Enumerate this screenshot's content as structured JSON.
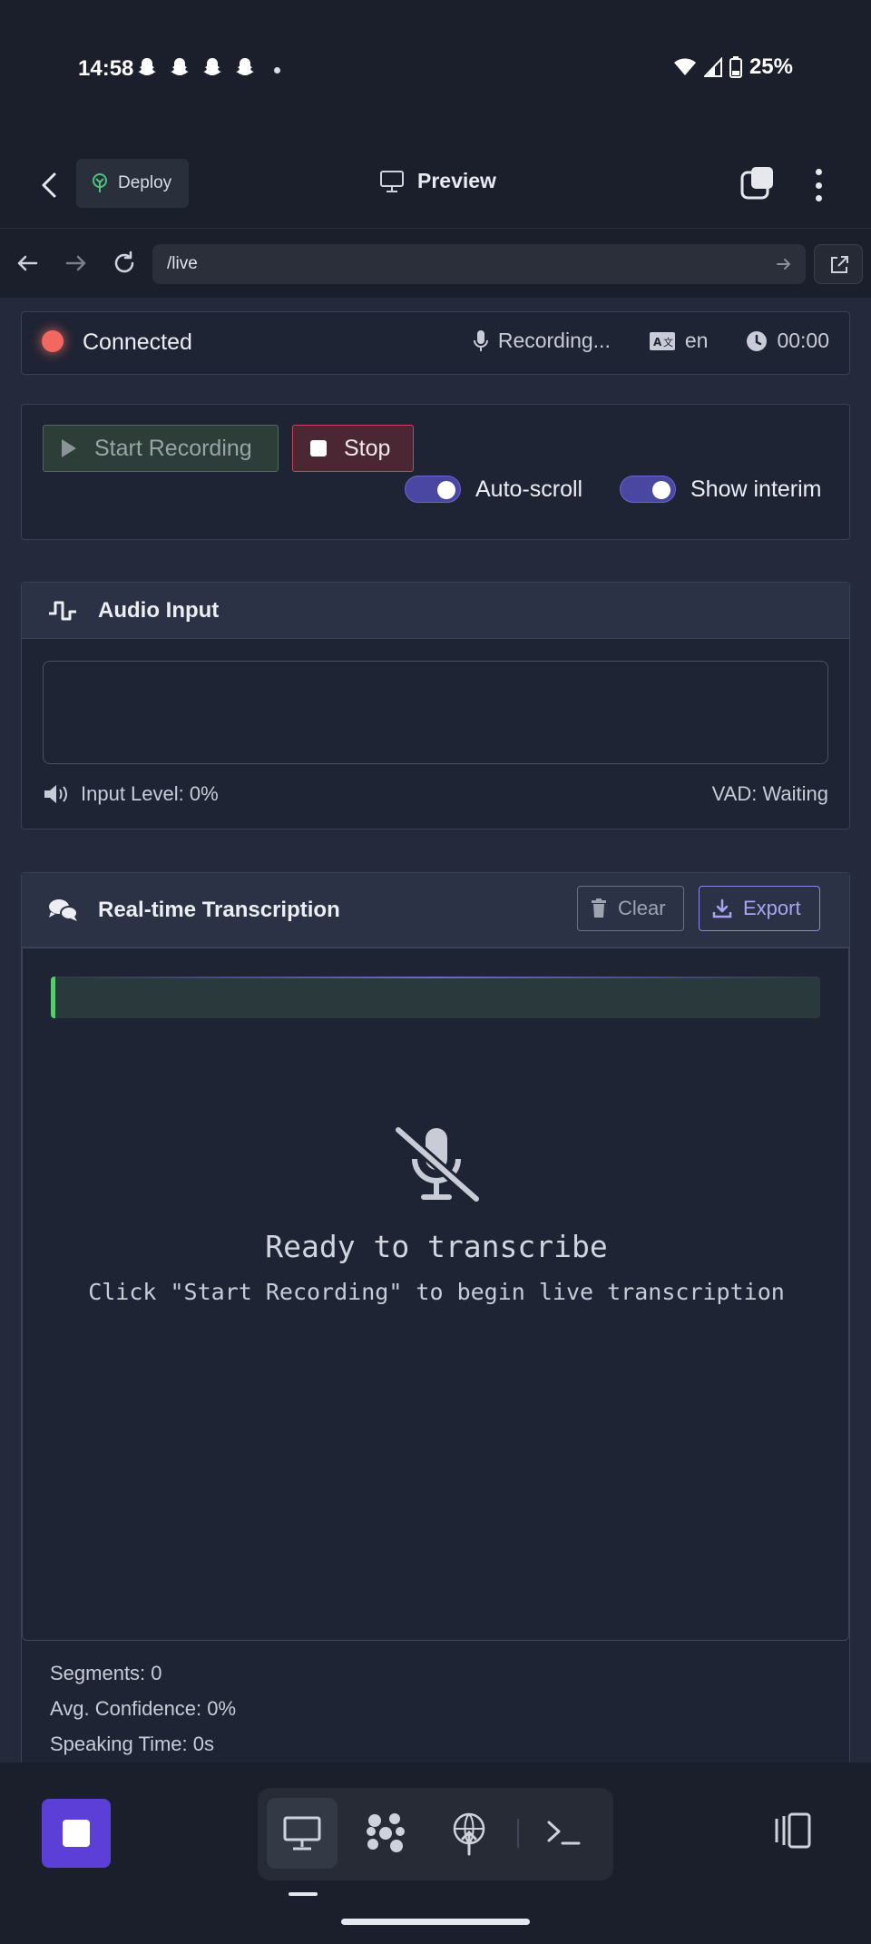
{
  "status_bar": {
    "time": "14:58",
    "battery": "25%"
  },
  "app_bar": {
    "deploy_label": "Deploy",
    "title": "Preview"
  },
  "url_bar": {
    "url": "/live"
  },
  "connection": {
    "status": "Connected",
    "recording_state": "Recording...",
    "language": "en",
    "timer": "00:00"
  },
  "controls": {
    "start_label": "Start Recording",
    "stop_label": "Stop",
    "auto_scroll_label": "Auto-scroll",
    "auto_scroll_on": true,
    "show_interim_label": "Show interim",
    "show_interim_on": true
  },
  "audio_input": {
    "title": "Audio Input",
    "input_level": "Input Level: 0%",
    "vad": "VAD: Waiting"
  },
  "transcription": {
    "title": "Real-time Transcription",
    "clear_label": "Clear",
    "export_label": "Export",
    "empty_title": "Ready to transcribe",
    "empty_hint": "Click \"Start Recording\" to begin live transcription"
  },
  "stats": {
    "segments": "Segments: 0",
    "confidence": "Avg. Confidence: 0%",
    "speaking_time": "Speaking Time: 0s"
  },
  "colors": {
    "accent": "#5b3fd6",
    "connected_dot": "#f2675f",
    "start_green": "#4b6a5a",
    "stop_red": "#c2475b",
    "toggle": "#4a47a3",
    "interim_bar": "#5acb70"
  }
}
